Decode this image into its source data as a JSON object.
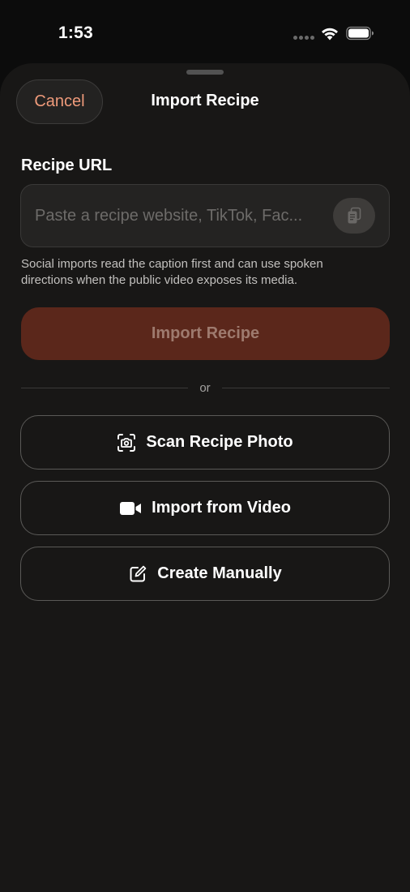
{
  "status_bar": {
    "time": "1:53",
    "wifi_icon": "wifi-icon",
    "battery_icon": "battery-full-icon"
  },
  "sheet": {
    "cancel_label": "Cancel",
    "title": "Import Recipe"
  },
  "url_field": {
    "label": "Recipe URL",
    "value": "",
    "placeholder": "Paste a recipe website, TikTok, Fac...",
    "paste_icon": "clipboard-icon"
  },
  "helper_text": "Social imports read the caption first and can use spoken directions when the public video exposes its media.",
  "import_button": {
    "label": "Import Recipe",
    "state": "disabled"
  },
  "divider": {
    "label": "or"
  },
  "options": [
    {
      "label": "Scan Recipe Photo",
      "icon": "camera-scan-icon"
    },
    {
      "label": "Import from Video",
      "icon": "video-camera-icon"
    },
    {
      "label": "Create Manually",
      "icon": "edit-square-icon"
    }
  ],
  "colors": {
    "accent": "#ee9a7a",
    "sheet_background": "#181716",
    "import_button_disabled": "#5b271b"
  }
}
